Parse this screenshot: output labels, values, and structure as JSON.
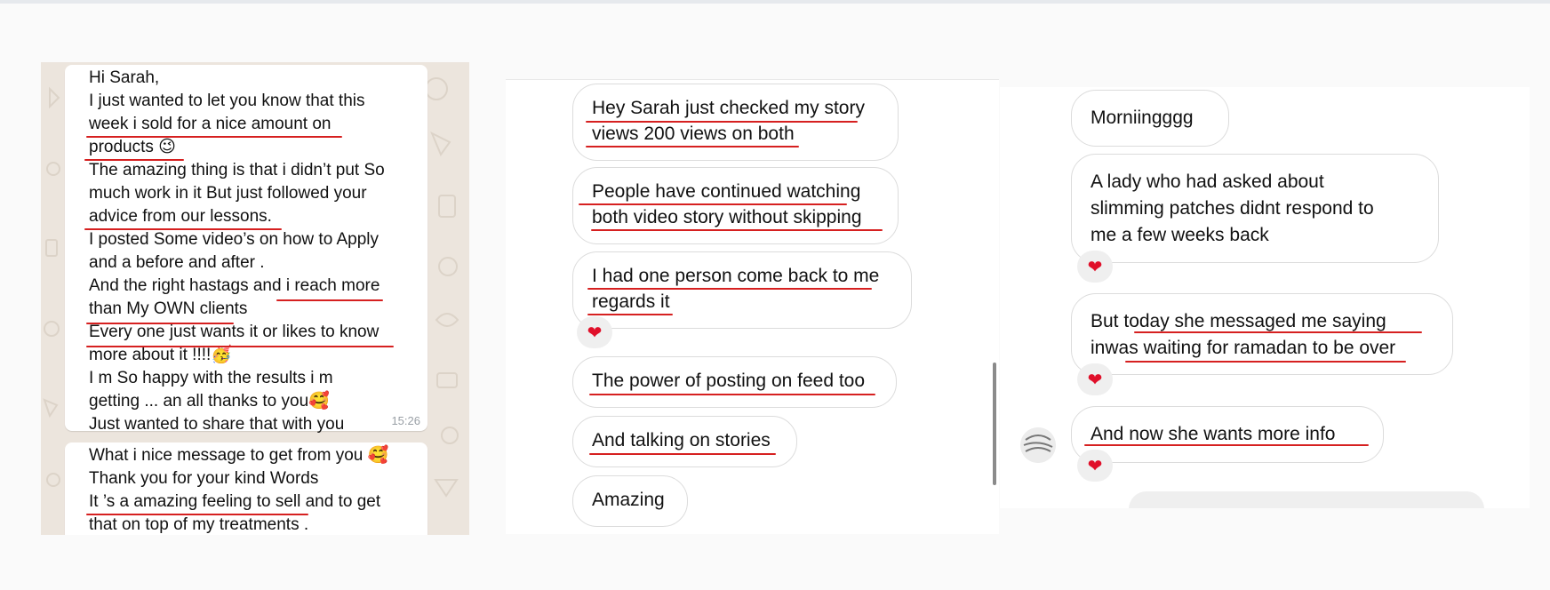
{
  "whatsapp": {
    "bubble1": {
      "lines": [
        "Hi Sarah,",
        "I just wanted to let you know that this",
        "week i sold for a nice amount on",
        "products 😉",
        "The amazing thing is that i didn’t put So",
        "much work in it But just followed your",
        "advice from our lessons.",
        "I posted Some video’s on how to Apply",
        "and a before and after .",
        "And the right hastags and i reach more",
        "than My OWN clients",
        "Every one just wants it or likes to know",
        "more about it !!!!🥳",
        "I m So happy with the results i m",
        "getting ... an all thanks to you🥰",
        "Just wanted to share that with you"
      ],
      "time": "15:26"
    },
    "bubble2": {
      "lines": [
        "What i nice message to get from you 🥰",
        "Thank you for your kind Words",
        "It ’s a amazing feeling to sell and to get",
        "that on top of my treatments ."
      ]
    }
  },
  "instagram_left": {
    "messages": [
      {
        "lines": [
          "Hey Sarah just checked my story",
          "views 200 views on both"
        ],
        "reaction": ""
      },
      {
        "lines": [
          "People have continued watching",
          "both video story without skipping"
        ],
        "reaction": ""
      },
      {
        "lines": [
          "I had one person come back to me",
          "regards it"
        ],
        "reaction": "❤"
      },
      {
        "lines": [
          "The power of posting on feed too"
        ],
        "reaction": ""
      },
      {
        "lines": [
          "And talking on stories"
        ],
        "reaction": ""
      },
      {
        "lines": [
          "Amazing"
        ],
        "reaction": ""
      }
    ]
  },
  "instagram_right": {
    "messages": [
      {
        "lines": [
          "Morniingggg"
        ],
        "reaction": ""
      },
      {
        "lines": [
          "A lady who had asked about",
          "slimming patches didnt respond to",
          "me a few weeks back"
        ],
        "reaction": "❤"
      },
      {
        "lines": [
          "But today she messaged me saying",
          "inwas waiting for ramadan to be over"
        ],
        "reaction": "❤"
      },
      {
        "lines": [
          "And now she wants more info"
        ],
        "reaction": "❤"
      }
    ]
  },
  "colors": {
    "underline": "#d62020",
    "heart": "#e0102a",
    "whatsapp_bg": "#ece5dd"
  }
}
